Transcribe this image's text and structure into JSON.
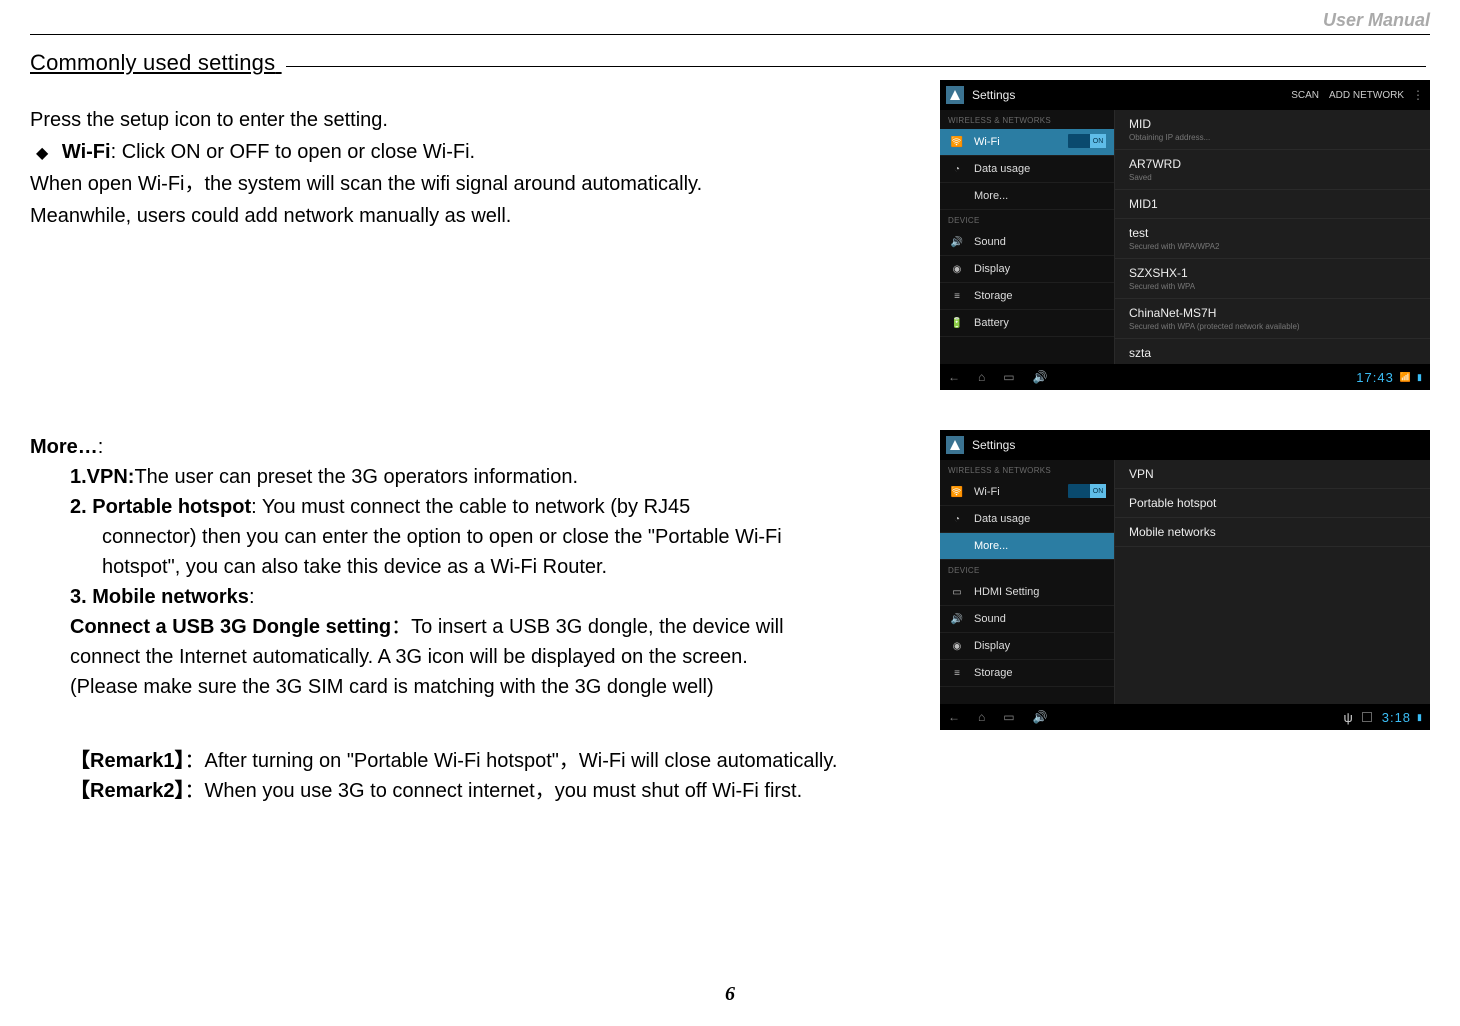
{
  "header": {
    "right": "User Manual"
  },
  "title": "Commonly used settings",
  "para1": {
    "line1": "Press the setup icon to enter the setting.",
    "bullet_strong": "Wi-Fi",
    "bullet_rest": ": Click ON or OFF to open or close Wi-Fi.",
    "line3": "When open Wi-Fi，the system will scan the wifi signal around automatically.",
    "line4": "Meanwhile, users could add network manually as well."
  },
  "screenshot1": {
    "title": "Settings",
    "scan": "SCAN",
    "add": "ADD NETWORK",
    "section1": "WIRELESS & NETWORKS",
    "section2": "DEVICE",
    "sidebar": [
      "Wi-Fi",
      "Data usage",
      "More...",
      "Sound",
      "Display",
      "Storage",
      "Battery"
    ],
    "toggle": "ON",
    "networks": [
      {
        "name": "MID",
        "sub": "Obtaining IP address..."
      },
      {
        "name": "AR7WRD",
        "sub": "Saved"
      },
      {
        "name": "MID1",
        "sub": ""
      },
      {
        "name": "test",
        "sub": "Secured with WPA/WPA2"
      },
      {
        "name": "SZXSHX-1",
        "sub": "Secured with WPA"
      },
      {
        "name": "ChinaNet-MS7H",
        "sub": "Secured with WPA (protected network available)"
      },
      {
        "name": "szta",
        "sub": ""
      }
    ],
    "time": "17:43"
  },
  "more_heading": "More…",
  "more_colon": ":",
  "item1_strong": "1.VPN:",
  "item1_rest": "The user can preset the 3G operators information.",
  "item2_strong": "2. Portable hotspot",
  "item2_rest": ": You must connect the cable to network (by RJ45",
  "item2_line2": "connector) then you can enter the option to open or close the \"Portable Wi-Fi",
  "item2_line3": "hotspot\", you can also take this device as a Wi-Fi Router.",
  "item3_strong": "3. Mobile networks",
  "item3_colon": ":",
  "item4_strong": "Connect a USB 3G Dongle setting",
  "item4_rest": "：To insert a USB 3G dongle, the device will",
  "item4_line2": "connect the Internet automatically. A 3G icon will be displayed on the screen.",
  "item4_line3": "(Please make sure the 3G SIM card is matching with the 3G dongle well)",
  "remark1_label": "【Remark1】",
  "remark1_text": "：After turning on \"Portable Wi-Fi hotspot\"，Wi-Fi will close automatically.",
  "remark2_label": "【Remark2】",
  "remark2_text": "：When you use 3G to connect internet，you must shut off Wi-Fi first.",
  "screenshot2": {
    "title": "Settings",
    "section1": "WIRELESS & NETWORKS",
    "section2": "DEVICE",
    "sidebar": [
      "Wi-Fi",
      "Data usage",
      "More...",
      "HDMI Setting",
      "Sound",
      "Display",
      "Storage"
    ],
    "toggle": "ON",
    "main_items": [
      "VPN",
      "Portable hotspot",
      "Mobile networks"
    ],
    "time": "3:18"
  },
  "page_number": "6"
}
